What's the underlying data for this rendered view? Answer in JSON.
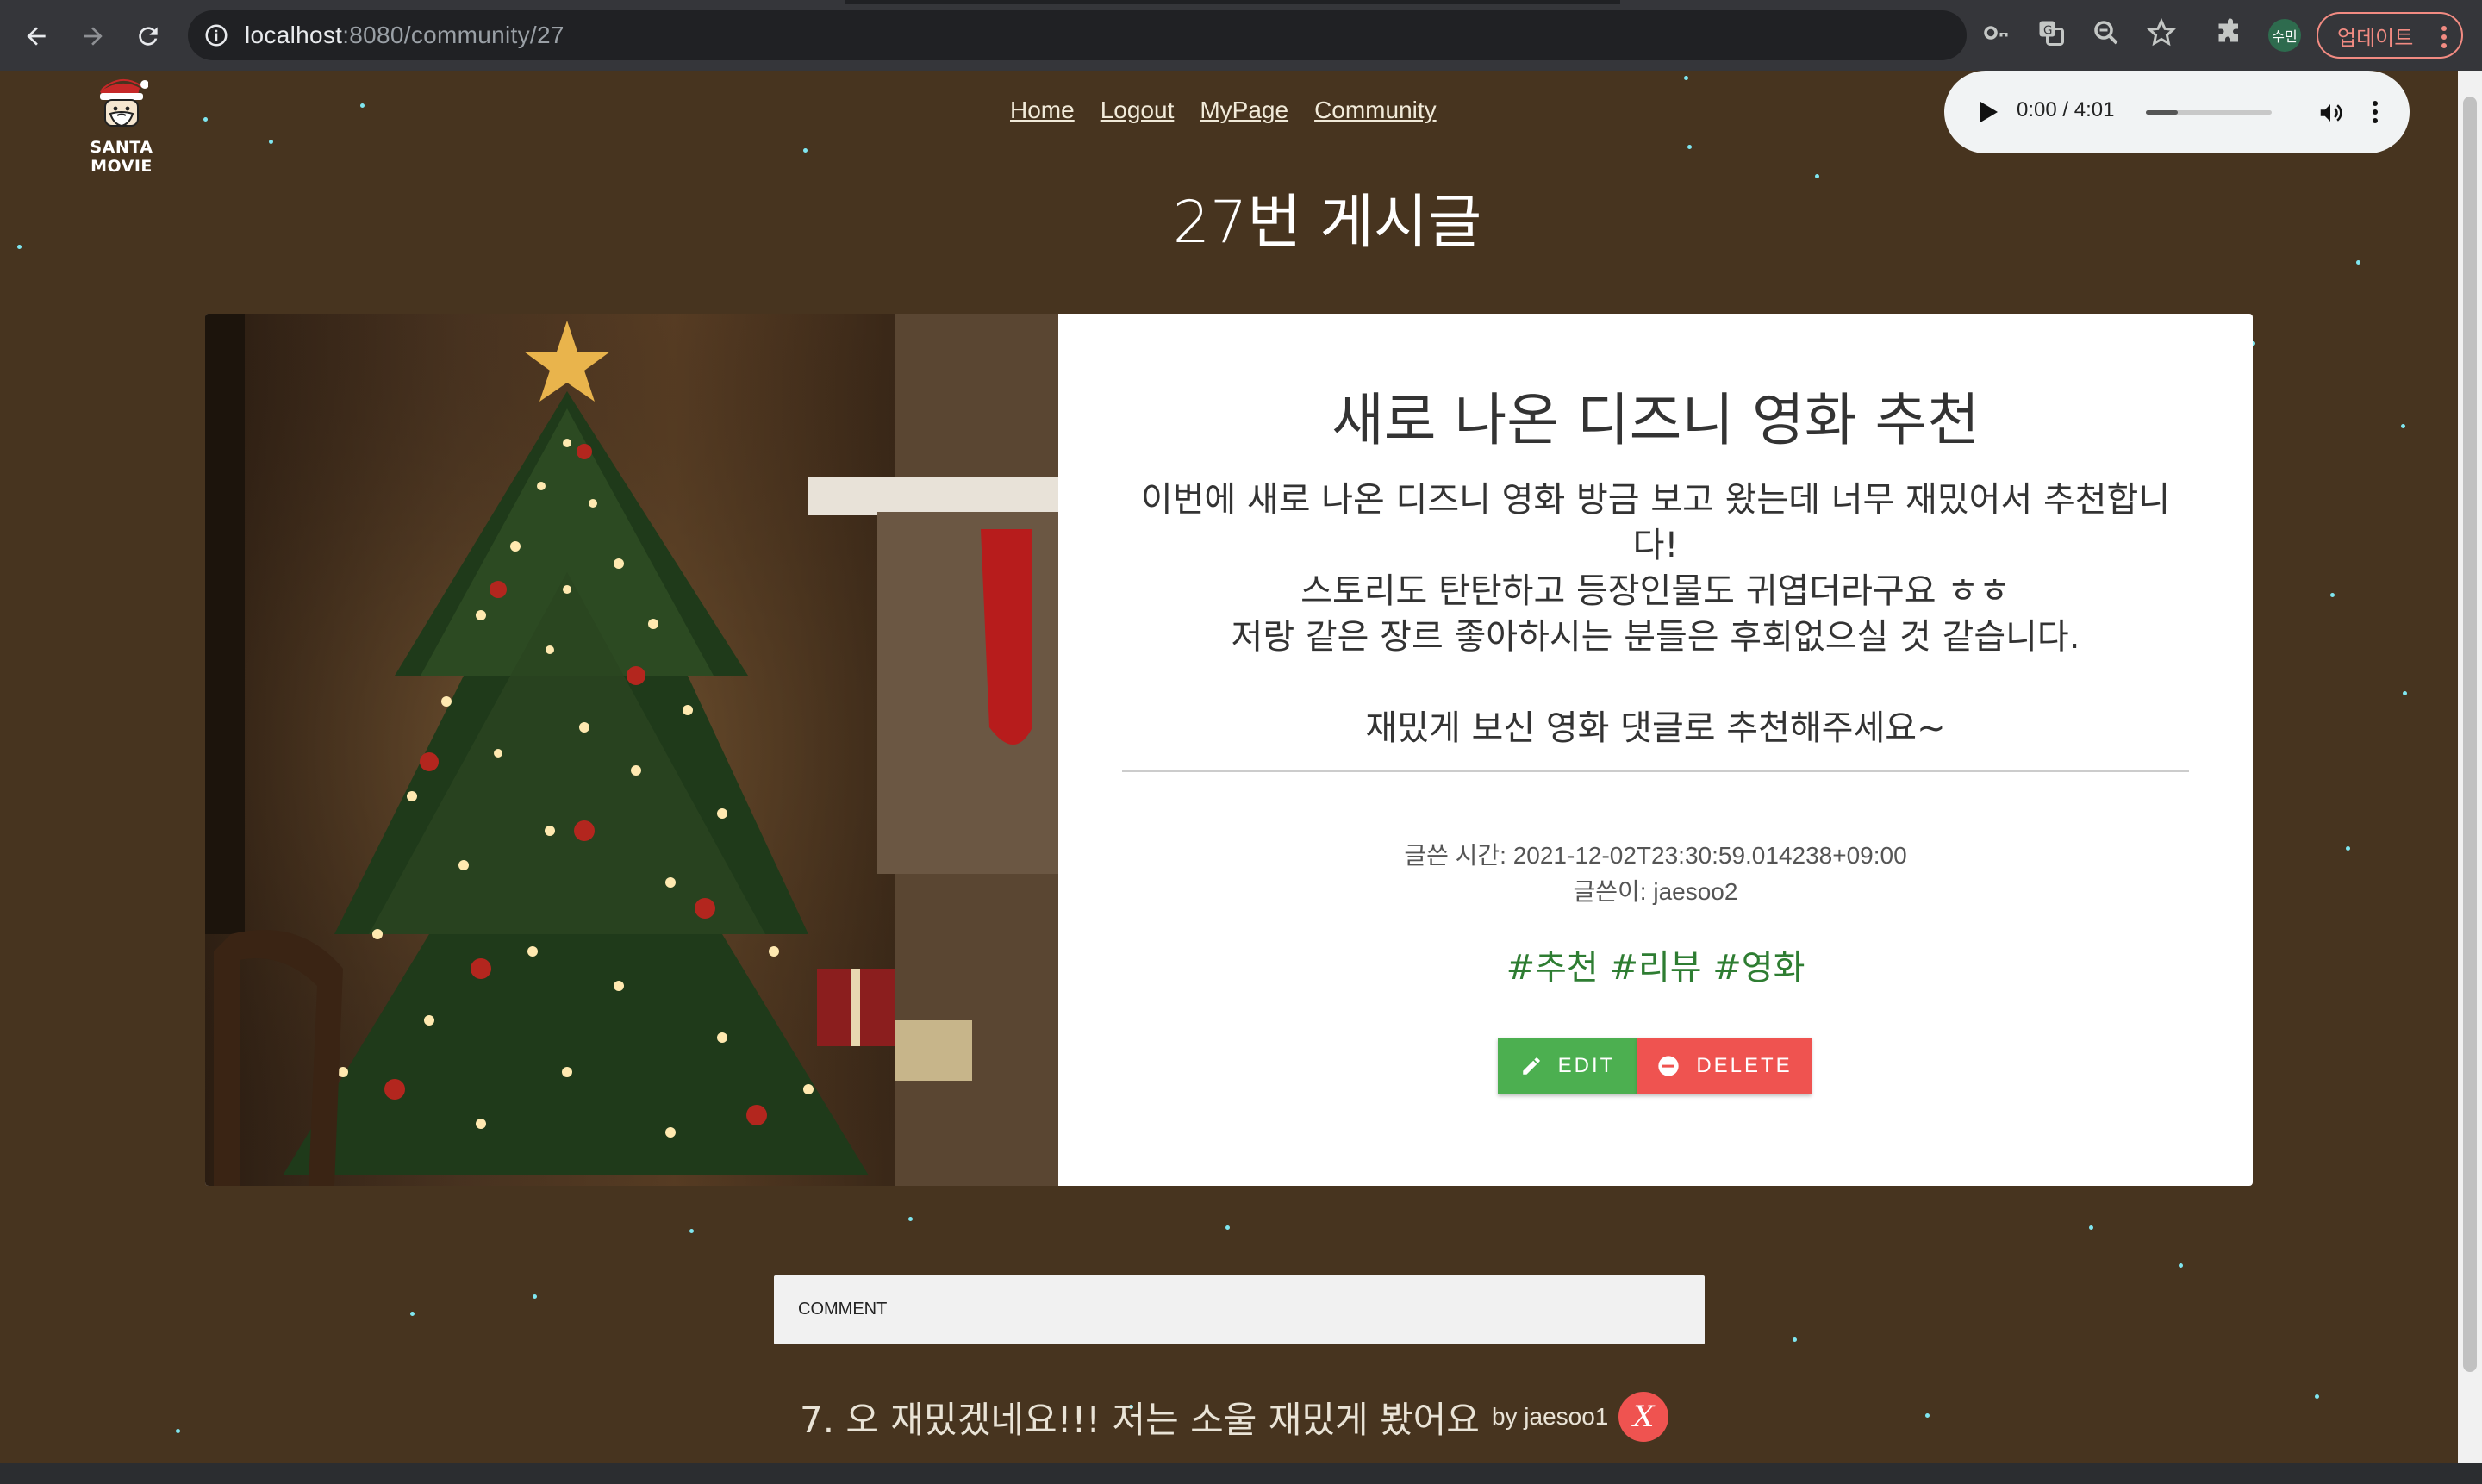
{
  "browser": {
    "url_host": "localhost",
    "url_path": ":8080/community/27",
    "profile_initials": "수민",
    "update_label": "업데이트"
  },
  "site": {
    "logo_text": "SANTA MOVIE",
    "nav": [
      "Home",
      "Logout",
      "MyPage",
      "Community"
    ]
  },
  "audio_player": {
    "time": "0:00 / 4:01",
    "progress": 0.25
  },
  "post": {
    "page_title": "27번 게시글",
    "title": "새로 나온 디즈니 영화 추천",
    "content": "이번에 새로 나온 디즈니 영화 방금 보고 왔는데 너무 재밌어서 추천합니다!\n스토리도 탄탄하고 등장인물도 귀엽더라구요 ㅎㅎ\n저랑 같은 장르 좋아하시는 분들은 후회없으실 것 같습니다.\n\n재밌게 보신 영화 댓글로 추천해주세요~",
    "created_label": "글쓴 시간: 2021-12-02T23:30:59.014238+09:00",
    "author_label": "글쓴이: jaesoo2",
    "tags": "#추천 #리뷰 #영화",
    "edit_label": "EDIT",
    "delete_label": "DELETE"
  },
  "comment_form": {
    "label": "COMMENT"
  },
  "comments": [
    {
      "text": "7. 오 재밌겠네요!!! 저는 소울 재밌게 봤어요",
      "by": "by jaesoo1",
      "delete": "X"
    }
  ],
  "colors": {
    "background": "#47341f",
    "edit": "#4caf50",
    "delete": "#ef5350",
    "tags": "#2e7d32"
  },
  "icons": [
    "back-icon",
    "forward-icon",
    "reload-icon",
    "info-icon",
    "key-icon",
    "translate-icon",
    "zoom-icon",
    "star-icon",
    "extensions-icon",
    "more-vert-icon",
    "santa-logo-icon",
    "play-icon",
    "volume-icon",
    "pencil-icon",
    "minus-circle-icon"
  ]
}
